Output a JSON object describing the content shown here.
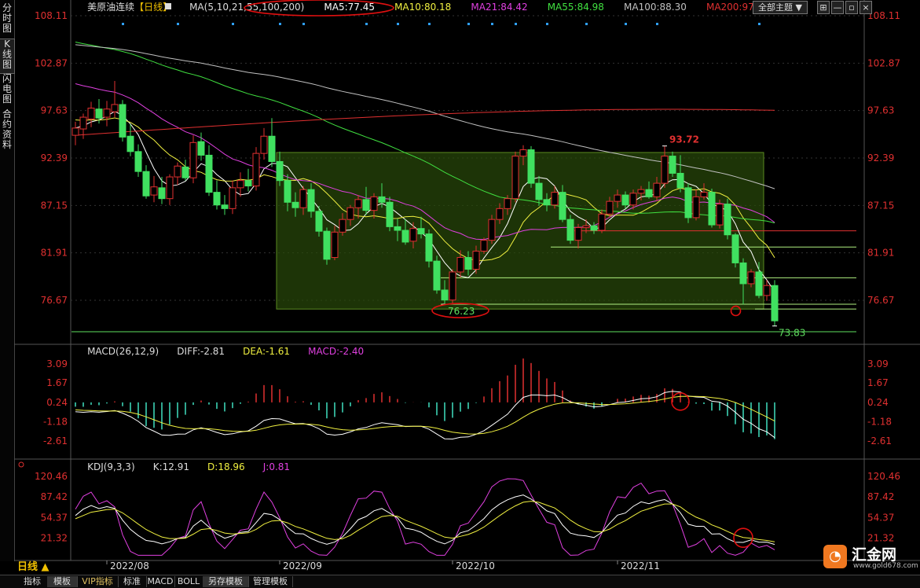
{
  "left_tabs": [
    {
      "label": "分时图",
      "active": false
    },
    {
      "label": "K线图",
      "active": true
    },
    {
      "label": "闪电图",
      "active": false
    },
    {
      "label": "合约资料",
      "active": false
    }
  ],
  "header": {
    "instrument": "美原油连续",
    "period_tag": "【日线】",
    "ma_label": "MA(5,10,21,55,100,200)",
    "ma5": "MA5:77.45",
    "ma10": "MA10:80.18",
    "ma21": "MA21:84.42",
    "ma55": "MA55:84.98",
    "ma100": "MA100:88.30",
    "ma200": "MA200:97.77",
    "theme_button": "全部主题",
    "theme_arrow": "▼"
  },
  "macd_header": {
    "label": "MACD(26,12,9)",
    "diff": "DIFF:-2.81",
    "dea": "DEA:-1.61",
    "macd": "MACD:-2.40"
  },
  "kdj_header": {
    "label": "KDJ(9,3,3)",
    "k": "K:12.91",
    "d": "D:18.96",
    "j": "J:0.81"
  },
  "period_label": "日线 ▲",
  "bottom_tabs": [
    {
      "label": "指标",
      "active": false,
      "vip": false
    },
    {
      "label": "模板",
      "active": true,
      "vip": false
    },
    {
      "label": "VIP指标",
      "active": false,
      "vip": true
    },
    {
      "label": "标准",
      "active": false,
      "vip": false
    },
    {
      "label": "MACD",
      "active": false,
      "vip": false
    },
    {
      "label": "BOLL",
      "active": false,
      "vip": false
    },
    {
      "label": "另存模板",
      "active": true,
      "vip": false
    },
    {
      "label": "管理模板",
      "active": false,
      "vip": false
    }
  ],
  "logo": {
    "name": "汇金网",
    "url": "www.gold678.com",
    "mark": "◔"
  },
  "colors": {
    "up": "#e03030",
    "down": "#40e060",
    "ma5": "#ffffff",
    "ma10": "#f0f040",
    "ma21": "#e040e0",
    "ma55": "#40e040",
    "ma100": "#c0c0c0",
    "ma200": "#e03030",
    "diff": "#ffffff",
    "dea": "#f0f040",
    "kdj_j": "#e040e0",
    "annotation": "#e01010"
  },
  "chart_data": [
    {
      "type": "candlestick",
      "title": "美原油连续【日线】",
      "y_ticks": [
        "108.11",
        "102.87",
        "97.63",
        "92.39",
        "87.15",
        "81.91",
        "76.67"
      ],
      "ylim": [
        72.5,
        108.11
      ],
      "x_ticks": [
        "2022/08",
        "2022/09",
        "2022/10",
        "2022/11"
      ],
      "x_tick_index": [
        4,
        26,
        48,
        69
      ],
      "ohlc": [
        [
          94.9,
          96.4,
          93.8,
          95.7
        ],
        [
          95.6,
          97.3,
          94.5,
          96.9
        ],
        [
          96.7,
          98.6,
          95.8,
          97.9
        ],
        [
          97.8,
          98.9,
          96.2,
          96.8
        ],
        [
          96.9,
          98.7,
          95.9,
          97.8
        ],
        [
          97.5,
          100.9,
          96.9,
          98.3
        ],
        [
          98.3,
          98.8,
          94.2,
          94.7
        ],
        [
          94.8,
          96.1,
          92.6,
          93.1
        ],
        [
          93.1,
          93.9,
          90.3,
          90.9
        ],
        [
          90.9,
          91.6,
          87.9,
          88.2
        ],
        [
          88.3,
          90.4,
          87.5,
          89.2
        ],
        [
          89.1,
          90.3,
          87.3,
          87.9
        ],
        [
          87.9,
          90.6,
          87.2,
          90.3
        ],
        [
          90.3,
          91.9,
          89.4,
          91.5
        ],
        [
          91.4,
          92.2,
          89.9,
          90.2
        ],
        [
          90.2,
          94.9,
          89.6,
          94.1
        ],
        [
          94.2,
          95.2,
          92.1,
          92.7
        ],
        [
          92.7,
          93.8,
          88.2,
          88.6
        ],
        [
          88.6,
          89.9,
          86.7,
          87.2
        ],
        [
          87.2,
          88.3,
          86.1,
          86.8
        ],
        [
          86.8,
          89.9,
          86.2,
          89.1
        ],
        [
          89.1,
          90.8,
          88.1,
          89.9
        ],
        [
          89.9,
          91.2,
          88.7,
          89.3
        ],
        [
          89.3,
          93.6,
          88.8,
          92.9
        ],
        [
          92.9,
          95.7,
          92.2,
          94.8
        ],
        [
          94.8,
          96.8,
          91.4,
          92.0
        ],
        [
          92.0,
          93.1,
          89.3,
          89.9
        ],
        [
          89.9,
          90.6,
          86.5,
          87.5
        ],
        [
          87.5,
          88.6,
          85.9,
          86.9
        ],
        [
          86.9,
          89.3,
          86.1,
          88.9
        ],
        [
          88.9,
          89.6,
          85.8,
          86.5
        ],
        [
          86.5,
          87.1,
          83.7,
          84.3
        ],
        [
          84.3,
          84.7,
          80.6,
          81.2
        ],
        [
          81.4,
          84.9,
          81.1,
          84.2
        ],
        [
          84.2,
          86.3,
          83.8,
          85.6
        ],
        [
          85.6,
          87.2,
          84.9,
          86.9
        ],
        [
          86.9,
          88.3,
          85.7,
          87.8
        ],
        [
          87.8,
          89.2,
          86.1,
          86.6
        ],
        [
          86.6,
          88.5,
          85.7,
          88.1
        ],
        [
          88.1,
          89.6,
          86.9,
          87.5
        ],
        [
          87.5,
          88.1,
          84.3,
          84.8
        ],
        [
          84.8,
          85.7,
          83.2,
          84.4
        ],
        [
          84.4,
          85.6,
          82.8,
          83.1
        ],
        [
          83.2,
          85.3,
          82.4,
          84.6
        ],
        [
          84.6,
          85.9,
          83.5,
          84.0
        ],
        [
          84.0,
          84.5,
          80.3,
          81.0
        ],
        [
          81.0,
          81.6,
          77.4,
          77.8
        ],
        [
          77.8,
          78.9,
          76.2,
          76.7
        ],
        [
          76.7,
          80.1,
          76.3,
          79.8
        ],
        [
          79.8,
          82.2,
          79.2,
          81.4
        ],
        [
          81.4,
          82.1,
          79.4,
          80.1
        ],
        [
          80.1,
          82.7,
          79.6,
          82.1
        ],
        [
          82.1,
          83.6,
          81.8,
          83.3
        ],
        [
          83.3,
          86.1,
          82.9,
          85.6
        ],
        [
          85.6,
          87.4,
          85.1,
          86.8
        ],
        [
          86.8,
          88.3,
          86.1,
          87.9
        ],
        [
          87.9,
          93.1,
          87.5,
          92.6
        ],
        [
          92.6,
          93.8,
          91.6,
          93.3
        ],
        [
          93.3,
          93.7,
          89.1,
          89.6
        ],
        [
          89.6,
          90.4,
          87.1,
          87.8
        ],
        [
          87.8,
          88.5,
          86.5,
          87.2
        ],
        [
          87.2,
          89.3,
          86.8,
          88.6
        ],
        [
          88.6,
          89.4,
          85.3,
          85.6
        ],
        [
          85.6,
          86.1,
          82.9,
          83.3
        ],
        [
          83.3,
          85.1,
          82.4,
          84.7
        ],
        [
          84.7,
          85.6,
          84.1,
          84.9
        ],
        [
          84.9,
          85.3,
          84.0,
          84.4
        ],
        [
          84.4,
          86.7,
          84.1,
          86.2
        ],
        [
          86.2,
          88.1,
          85.8,
          87.6
        ],
        [
          87.6,
          88.9,
          86.9,
          88.3
        ],
        [
          88.3,
          88.7,
          86.8,
          87.2
        ],
        [
          87.2,
          88.9,
          86.7,
          88.5
        ],
        [
          88.5,
          89.3,
          87.7,
          88.9
        ],
        [
          88.9,
          89.8,
          87.9,
          88.1
        ],
        [
          88.1,
          90.3,
          87.6,
          89.6
        ],
        [
          89.6,
          93.72,
          89.1,
          92.6
        ],
        [
          92.6,
          93.1,
          90.3,
          90.7
        ],
        [
          90.7,
          92.7,
          88.6,
          89.1
        ],
        [
          89.1,
          89.6,
          85.2,
          85.8
        ],
        [
          85.8,
          88.9,
          85.5,
          88.1
        ],
        [
          88.1,
          89.6,
          87.8,
          88.6
        ],
        [
          88.6,
          89.0,
          84.7,
          85.0
        ],
        [
          85.0,
          87.8,
          84.6,
          87.3
        ],
        [
          87.3,
          87.9,
          83.4,
          83.9
        ],
        [
          83.9,
          84.1,
          80.3,
          80.8
        ],
        [
          80.8,
          81.3,
          76.2,
          78.5
        ],
        [
          78.5,
          80.1,
          78.1,
          79.8
        ],
        [
          79.8,
          80.9,
          76.9,
          77.2
        ],
        [
          77.2,
          78.9,
          76.6,
          78.3
        ],
        [
          78.3,
          78.9,
          73.83,
          74.4
        ]
      ],
      "annotations": [
        {
          "label": "93.72",
          "price": 93.72,
          "index": 75
        },
        {
          "label": "76.23",
          "price": 76.23,
          "index": 47
        },
        {
          "label": "73.83",
          "price": 73.83,
          "index": 89
        }
      ],
      "box": {
        "x_start": 26,
        "x_end": 89,
        "low": 75.7,
        "high": 93.0
      },
      "support_lines": [
        84.35,
        82.55,
        79.15,
        76.23,
        75.7,
        73.2
      ],
      "support_line_start": [
        64,
        61,
        47,
        47,
        87,
        0
      ],
      "marker_row_indices": [
        6,
        13,
        20,
        26,
        29,
        37,
        41,
        45,
        50,
        53,
        56,
        60,
        65,
        70,
        74,
        87
      ]
    },
    {
      "type": "bar+line",
      "title": "MACD(26,12,9)",
      "y_ticks": [
        "3.09",
        "1.67",
        "0.24",
        "-1.18",
        "-2.61"
      ],
      "ylim": [
        -3.6,
        3.6
      ]
    },
    {
      "type": "line",
      "title": "KDJ(9,3,3)",
      "y_ticks": [
        "120.46",
        "87.42",
        "54.37",
        "21.32"
      ],
      "ylim": [
        -8,
        128
      ]
    }
  ]
}
